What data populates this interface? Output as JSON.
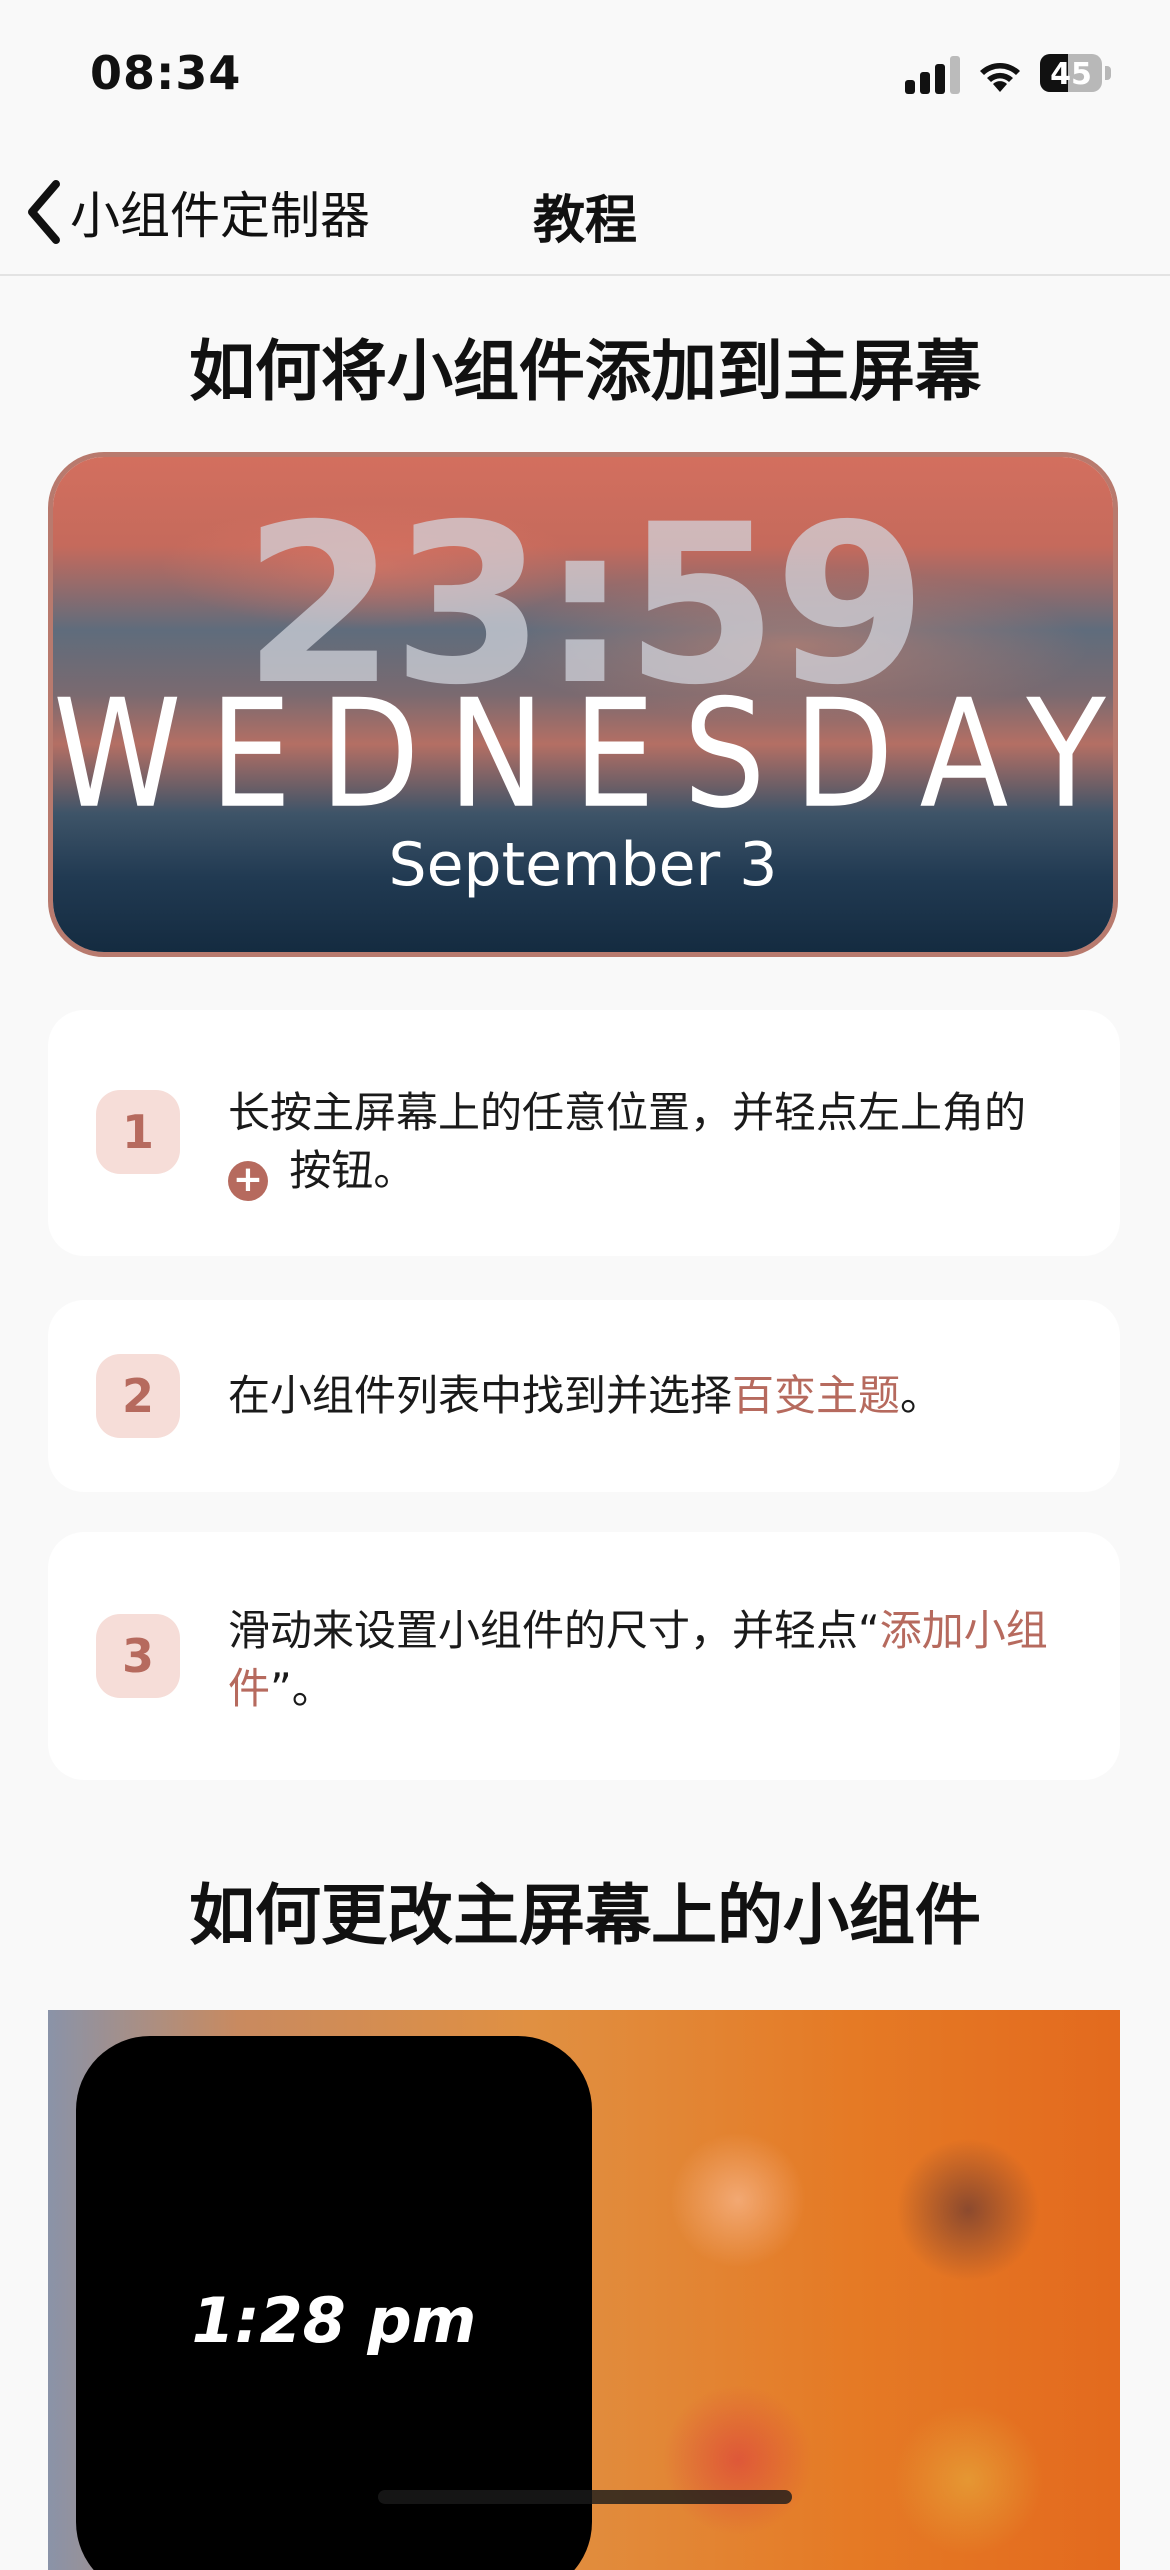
{
  "status": {
    "time": "08:34",
    "battery": "45",
    "battery_level": 0.45
  },
  "nav": {
    "back_label": "小组件定制器",
    "title": "教程"
  },
  "section1": {
    "title": "如何将小组件添加到主屏幕"
  },
  "hero": {
    "clock": "23:59",
    "day": "WEDNESDAY",
    "date": "September 3"
  },
  "steps": [
    {
      "number": "1",
      "text_before": "长按主屏幕上的任意位置，并轻点左上角的",
      "text_after": " 按钮。",
      "icon": "plus-circle-icon"
    },
    {
      "number": "2",
      "text_before": "在小组件列表中找到并选择",
      "highlight": "百变主题",
      "text_after": "。"
    },
    {
      "number": "3",
      "text_before": "滑动来设置小组件的尺寸，并轻点“",
      "highlight": "添加小组件",
      "text_after": "”。"
    }
  ],
  "section2": {
    "title": "如何更改主屏幕上的小组件"
  },
  "demo": {
    "widget_time": "1:28 pm"
  },
  "colors": {
    "accent": "#b66a5e",
    "badge_bg": "#f6ddd8",
    "background": "#f9f9f9"
  }
}
